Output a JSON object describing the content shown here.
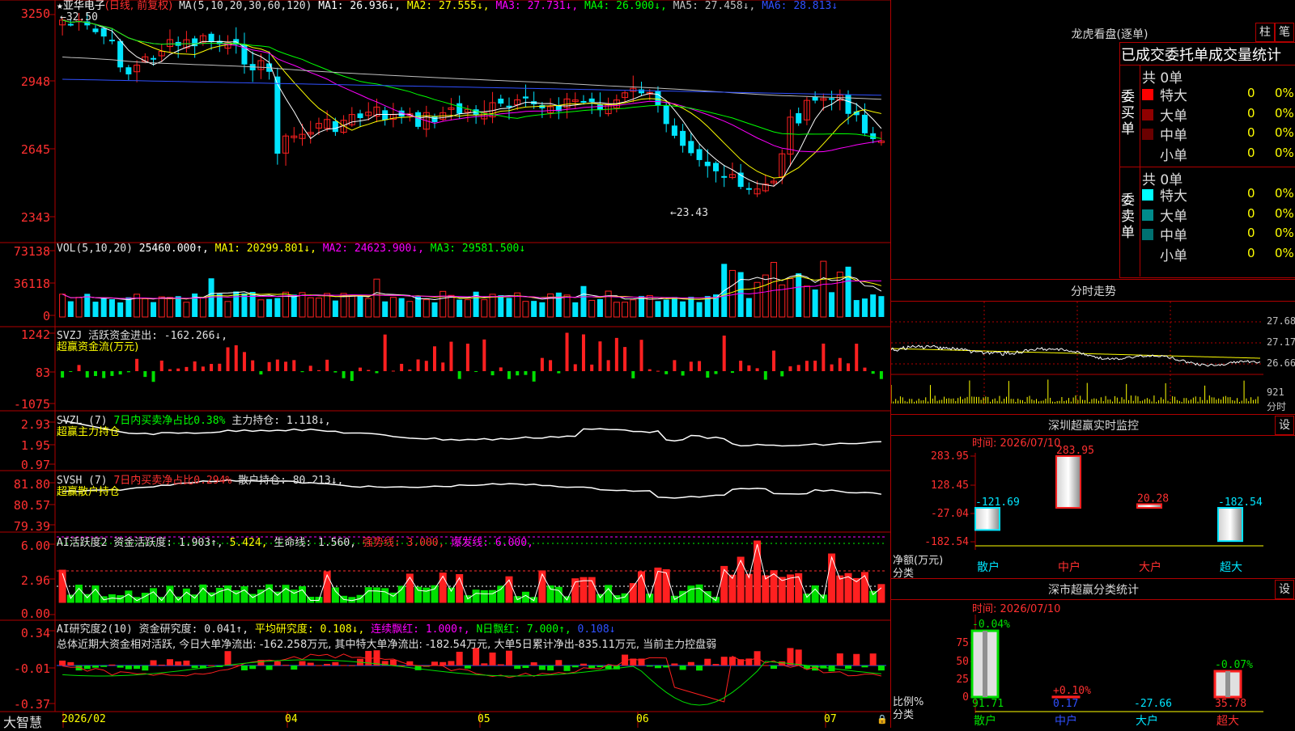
{
  "stock": {
    "name": "亚华电子",
    "period": "(日线, 前复权)",
    "high_mark": "32.50",
    "low_mark": "←23.43"
  },
  "main_ma": {
    "label": "MA(5,10,20,30,60,120)",
    "items": [
      {
        "t": "MA1: 26.936↓,",
        "c": "#ffffff"
      },
      {
        "t": "MA2: 27.555↓,",
        "c": "#ffff00"
      },
      {
        "t": "MA3: 27.731↓,",
        "c": "#ff00ff"
      },
      {
        "t": "MA4: 26.900↓,",
        "c": "#00ff00"
      },
      {
        "t": "MA5: 27.458↓,",
        "c": "#c0c0c0"
      },
      {
        "t": "MA6: 28.813↓",
        "c": "#3050ff"
      }
    ]
  },
  "main_axis": [
    "3250",
    "2948",
    "2645",
    "2343"
  ],
  "vol": {
    "label": "VOL(5,10,20)",
    "items": [
      {
        "t": "25460.000↑,",
        "c": "#ffffff"
      },
      {
        "t": "MA1: 20299.801↓,",
        "c": "#ffff00"
      },
      {
        "t": "MA2: 24623.900↓,",
        "c": "#ff00ff"
      },
      {
        "t": "MA3: 29581.500↓",
        "c": "#00ff00"
      }
    ],
    "axis": [
      "73138",
      "36118",
      "0"
    ]
  },
  "svzj": {
    "label": "SVZJ  活跃资金进出: -162.266↓,",
    "sub": "超赢资金流(万元)",
    "axis": [
      "1242",
      "83",
      "-1075"
    ]
  },
  "svzl": {
    "label_a": "SVZL (7) ",
    "label_b": "7日内买卖净占比0.38% ",
    "label_c": "主力持仓: 1.118↓,",
    "sub": "超赢主力持仓",
    "axis": [
      "2.93",
      "1.95",
      "0.97"
    ]
  },
  "svsh": {
    "label_a": "SVSH (7) ",
    "label_b": "7日内买卖净占比0.294% ",
    "label_c": "散户持仓: 80.213↓,",
    "sub": "超赢散户持仓",
    "axis": [
      "81.80",
      "80.57",
      "79.39"
    ]
  },
  "ai_act": {
    "items": [
      {
        "t": "AI活跃度2 资金活跃度: 1.903↑,",
        "c": "#e0e0e0"
      },
      {
        "t": "5.424,",
        "c": "#ffff00"
      },
      {
        "t": " 生命线: 1.560,",
        "c": "#e0e0e0"
      },
      {
        "t": " 强势线: 3.000,",
        "c": "#ff3030"
      },
      {
        "t": " 爆发线: 6.000,",
        "c": "#ff00ff"
      }
    ],
    "axis": [
      "6.00",
      "2.96",
      "0.00"
    ]
  },
  "ai_res": {
    "items": [
      {
        "t": "AI研究度2(10) 资金研究度: 0.041↑,",
        "c": "#e0e0e0"
      },
      {
        "t": "平均研究度: 0.108↓,",
        "c": "#ffff00"
      },
      {
        "t": "连续飘红: 1.000↑,",
        "c": "#ff00ff"
      },
      {
        "t": "N日飘红: 7.000↑,",
        "c": "#00ff00"
      },
      {
        "t": "0.108↓",
        "c": "#3050ff"
      }
    ],
    "summary": "总体近期大资金相对活跃, 今日大单净流出: -162.258万元, 其中特大单净流出: -182.54万元, 大单5日累计净出-835.11万元, 当前主力控盘弱",
    "axis": [
      "0.34",
      "-0.01",
      "-0.37"
    ]
  },
  "date_axis": {
    "brand": "大智慧",
    "labels": [
      {
        "t": "2026/02",
        "c": "#ffff00"
      },
      {
        "t": "04",
        "c": "#ffff00"
      },
      {
        "t": "05",
        "c": "#ffff00"
      },
      {
        "t": "06",
        "c": "#ffff00"
      },
      {
        "t": "07",
        "c": "#ffff00"
      }
    ]
  },
  "dragon": {
    "title": "龙虎看盘(逐单)",
    "btn_a": "柱",
    "btn_b": "笔",
    "header": "已成交委托单成交量统计",
    "buy": {
      "side": "委买单",
      "total": "共 0单",
      "rows": [
        {
          "label": "特大",
          "count": "0",
          "pct": "0%",
          "color": "#ff0000"
        },
        {
          "label": "大单",
          "count": "0",
          "pct": "0%",
          "color": "#900000"
        },
        {
          "label": "中单",
          "count": "0",
          "pct": "0%",
          "color": "#6a0000"
        },
        {
          "label": "小单",
          "count": "0",
          "pct": "0%",
          "color": ""
        }
      ]
    },
    "sell": {
      "side": "委卖单",
      "total": "共 0单",
      "rows": [
        {
          "label": "特大",
          "count": "0",
          "pct": "0%",
          "color": "#00ffff"
        },
        {
          "label": "大单",
          "count": "0",
          "pct": "0%",
          "color": "#008b8b"
        },
        {
          "label": "中单",
          "count": "0",
          "pct": "0%",
          "color": "#007070"
        },
        {
          "label": "小单",
          "count": "0",
          "pct": "0%",
          "color": ""
        }
      ]
    }
  },
  "intraday": {
    "title": "分时走势",
    "axis": [
      "27.68",
      "27.17",
      "26.66",
      "921",
      "分时"
    ]
  },
  "monitor": {
    "title": "深圳超赢实时监控",
    "btn": "设",
    "time": "时间: 2026/07/10",
    "ylabel_a": "净额(万元)",
    "ylabel_b": "分类",
    "axis": [
      "283.95",
      "128.45",
      "-27.04",
      "-182.54"
    ],
    "bars": [
      {
        "cat": "散户",
        "value": -121.69,
        "label": "-121.69"
      },
      {
        "cat": "中户",
        "value": 283.95,
        "label": "283.95"
      },
      {
        "cat": "大户",
        "value": 20.28,
        "label": "20.28"
      },
      {
        "cat": "超大",
        "value": -182.54,
        "label": "-182.54"
      }
    ]
  },
  "classify": {
    "title": "深市超赢分类统计",
    "btn": "设",
    "time": "时间: 2026/07/10",
    "ylabel_a": "比例%",
    "ylabel_b": "分类",
    "axis": [
      "75",
      "50",
      "25",
      "0"
    ],
    "bars": [
      {
        "cat": "散户",
        "value": 91.71,
        "label": "91.71",
        "delta": "-0.04%"
      },
      {
        "cat": "中户",
        "value": 0.17,
        "label": "0.17",
        "delta": "+0.10%"
      },
      {
        "cat": "大户",
        "value": -27.66,
        "label": "-27.66",
        "delta": ""
      },
      {
        "cat": "超大",
        "value": 35.78,
        "label": "35.78",
        "delta": "-0.07%"
      }
    ]
  },
  "colors": {
    "up": "#ff2020",
    "down": "#00e5ff",
    "grid": "#b00000"
  },
  "chart_data": {
    "type": "candlestick",
    "title": "亚华电子",
    "high": 32.5,
    "low": 23.43,
    "yaxis_labels": [
      "3250",
      "2948",
      "2645",
      "2343"
    ],
    "xaxis_labels": [
      "2026/02",
      "04",
      "05",
      "06",
      "07"
    ]
  }
}
